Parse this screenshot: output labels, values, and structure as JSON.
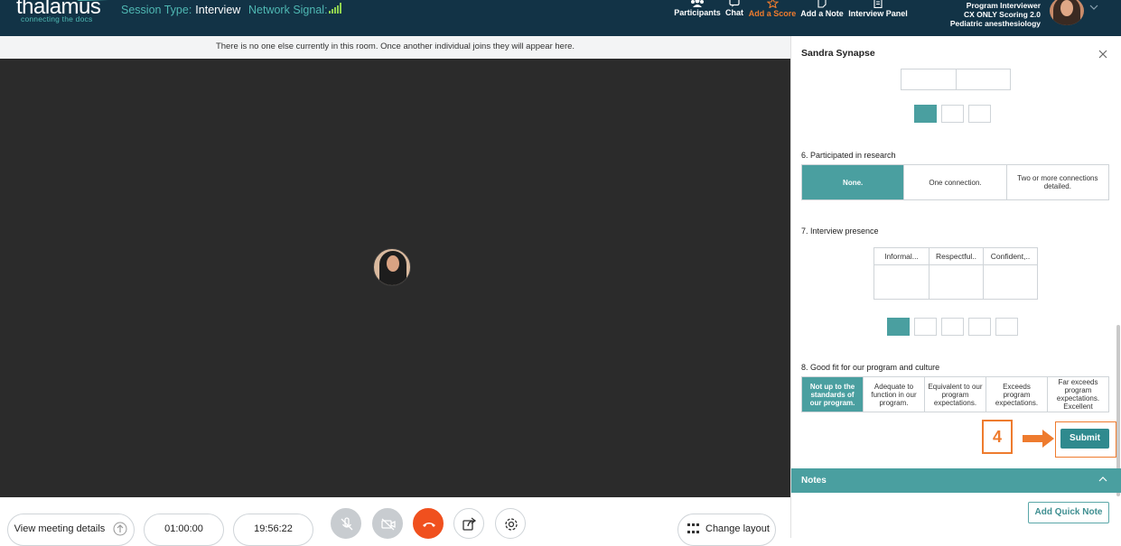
{
  "brand": {
    "name": "thalamus",
    "tagline": "connecting the docs"
  },
  "session": {
    "type_label": "Session Type:",
    "type_value": "Interview",
    "signal_label": "Network Signal:"
  },
  "nav": [
    {
      "label": "Participants",
      "icon": "participants-icon"
    },
    {
      "label": "Chat",
      "icon": "chat-icon"
    },
    {
      "label": "Add a Score",
      "icon": "star-icon",
      "active": true
    },
    {
      "label": "Add a Note",
      "icon": "note-icon"
    },
    {
      "label": "Interview Panel",
      "icon": "document-icon"
    }
  ],
  "user": {
    "role": "Program Interviewer",
    "program": "CX ONLY Scoring 2.0",
    "specialty": "Pediatric anesthesiology"
  },
  "notice": "There is no one else currently in this room. Once another individual joins they will appear here.",
  "controls": {
    "view_details": "View meeting details",
    "timer_elapsed": "01:00:00",
    "timer_clock": "19:56:22",
    "change_layout": "Change layout"
  },
  "panel": {
    "title": "Sandra Synapse",
    "q6": {
      "label": "6. Participated in research",
      "options": [
        "None.",
        "One connection.",
        "Two or more connections detailed."
      ],
      "selected": 0
    },
    "q7": {
      "label": "7. Interview presence",
      "headers": [
        "Informal...",
        "Respectful..",
        "Confident,.."
      ],
      "scale_selected": 1
    },
    "q8": {
      "label": "8. Good fit for our program and culture",
      "options": [
        "Not up to the standards of our program.",
        "Adequate to function in our program.",
        "Equivalent to our program expectations.",
        "Exceeds program expectations.",
        "Far exceeds program expectations. Excellent"
      ],
      "selected": 0
    },
    "submit": "Submit",
    "step_badge": "4",
    "notes_title": "Notes",
    "add_quick_note": "Add Quick Note"
  },
  "colors": {
    "topbar": "#123346",
    "teal": "#4a9fa0",
    "accent": "#ee7b2e",
    "video_bg": "#2b2b2b",
    "end_call": "#f0501e"
  }
}
